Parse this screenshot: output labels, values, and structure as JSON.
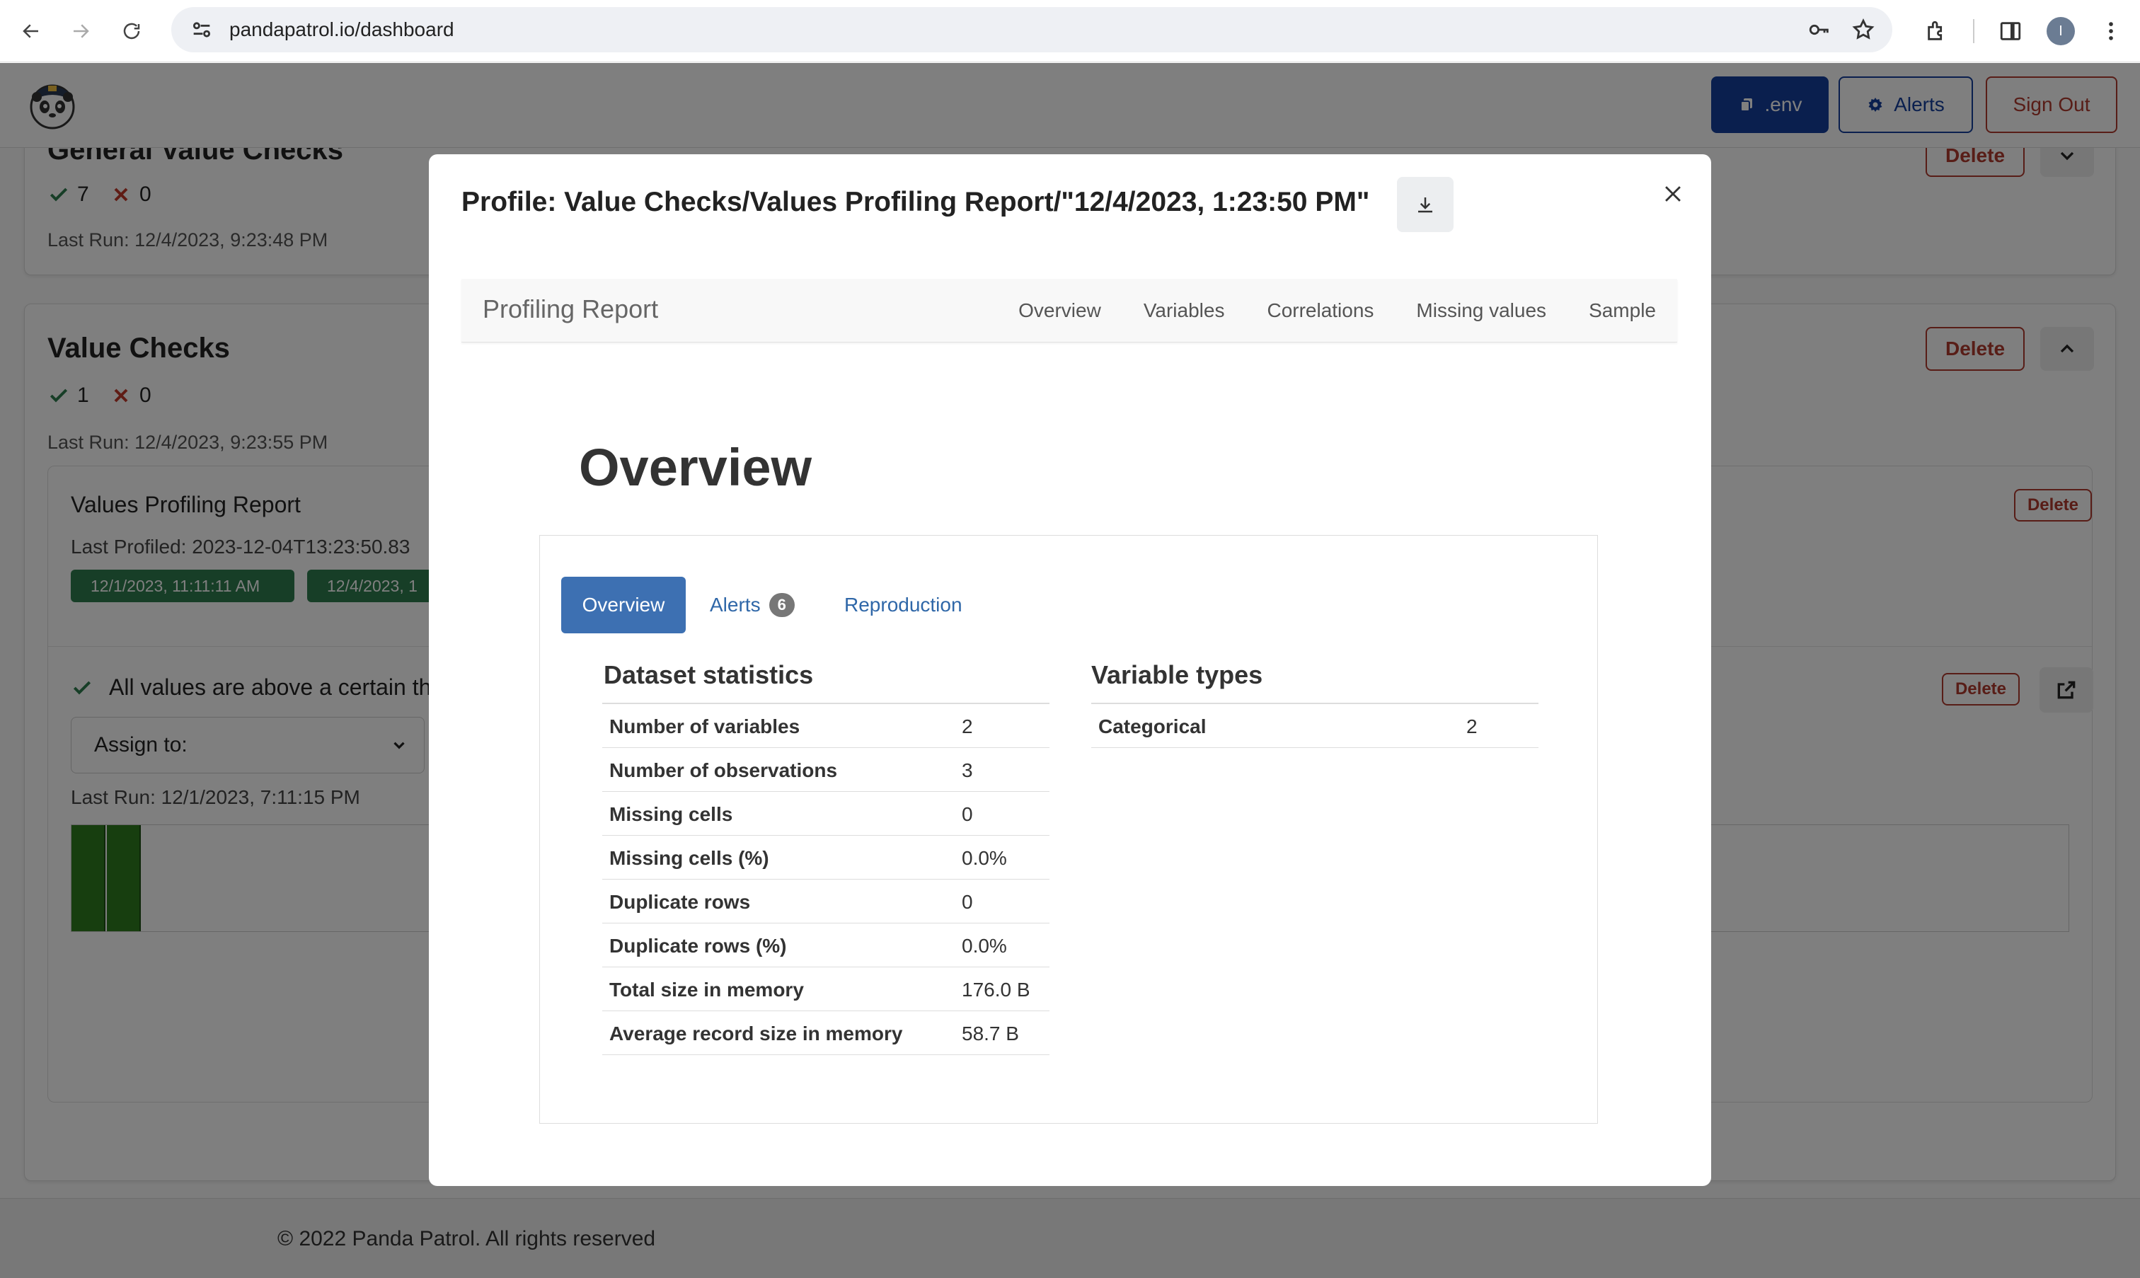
{
  "browser": {
    "url": "pandapatrol.io/dashboard",
    "profile_initial": "I"
  },
  "header": {
    "env_label": ".env",
    "alerts_label": "Alerts",
    "signout_label": "Sign Out"
  },
  "general_checks": {
    "title": "General Value Checks",
    "passed": "7",
    "failed": "0",
    "last_run": "Last Run: 12/4/2023, 9:23:48 PM",
    "delete_label": "Delete"
  },
  "value_checks": {
    "title": "Value Checks",
    "passed": "1",
    "failed": "0",
    "last_run": "Last Run: 12/4/2023, 9:23:55 PM",
    "delete_label": "Delete",
    "report": {
      "title": "Values Profiling Report",
      "last_profiled": "Last Profiled: 2023-12-04T13:23:50.83",
      "delete_label": "Delete",
      "chips": [
        "12/1/2023, 11:11:11 AM",
        "12/4/2023, 1"
      ]
    },
    "check": {
      "text": "All values are above a certain th",
      "delete_label": "Delete",
      "assign_label": "Assign to:",
      "last_run": "Last Run: 12/1/2023, 7:11:15 PM"
    }
  },
  "footer": {
    "text": "© 2022 Panda Patrol. All rights reserved"
  },
  "modal": {
    "title": "Profile: Value Checks/Values Profiling Report/\"12/4/2023, 1:23:50 PM\"",
    "report_nav": {
      "brand": "Profiling Report",
      "links": [
        "Overview",
        "Variables",
        "Correlations",
        "Missing values",
        "Sample"
      ]
    },
    "heading": "Overview",
    "tabs": {
      "overview": "Overview",
      "alerts": "Alerts",
      "alerts_count": "6",
      "reproduction": "Reproduction"
    },
    "dataset_statistics": {
      "title": "Dataset statistics",
      "rows": [
        {
          "label": "Number of variables",
          "value": "2"
        },
        {
          "label": "Number of observations",
          "value": "3"
        },
        {
          "label": "Missing cells",
          "value": "0"
        },
        {
          "label": "Missing cells (%)",
          "value": "0.0%"
        },
        {
          "label": "Duplicate rows",
          "value": "0"
        },
        {
          "label": "Duplicate rows (%)",
          "value": "0.0%"
        },
        {
          "label": "Total size in memory",
          "value": "176.0 B"
        },
        {
          "label": "Average record size in memory",
          "value": "58.7 B"
        }
      ]
    },
    "variable_types": {
      "title": "Variable types",
      "rows": [
        {
          "label": "Categorical",
          "value": "2"
        }
      ]
    }
  },
  "colors": {
    "primary": "#143f9c",
    "danger": "#b03a2e",
    "success": "#2e7d4f",
    "report_tab": "#3d70b2"
  }
}
